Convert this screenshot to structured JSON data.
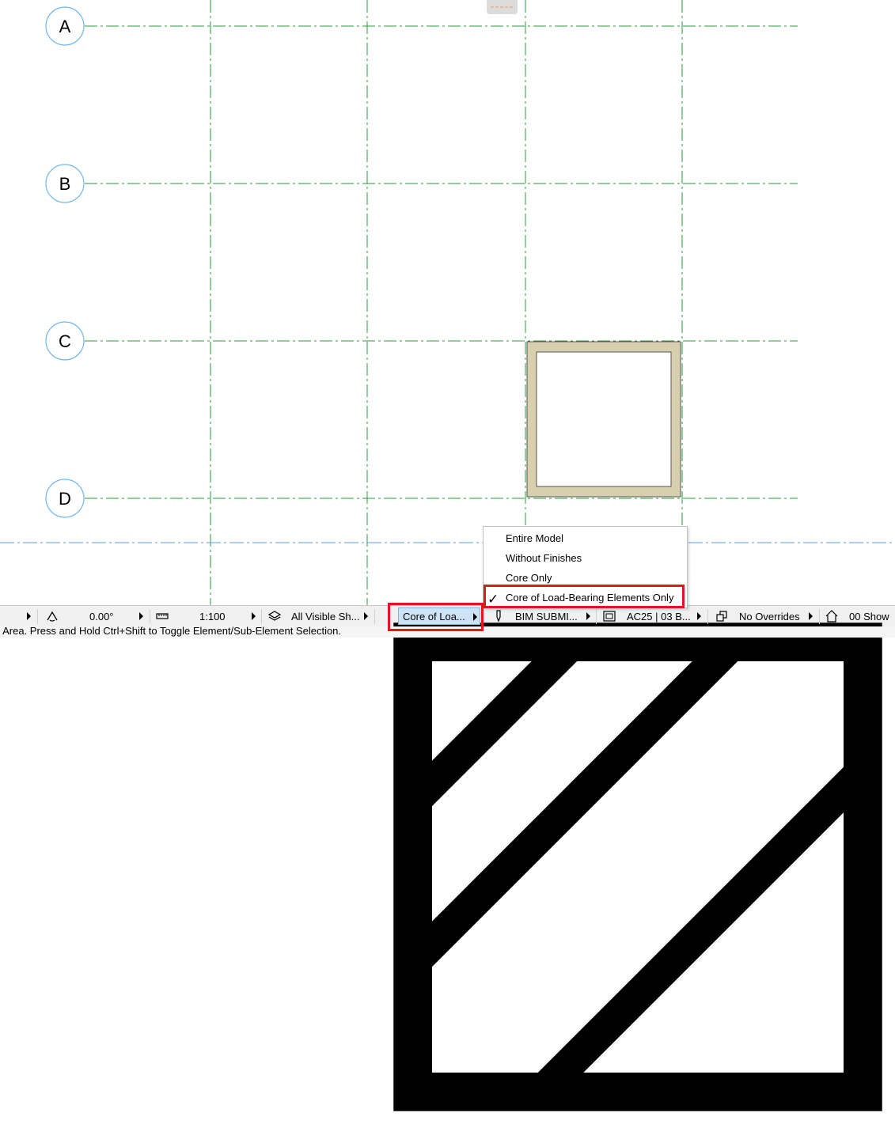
{
  "grid_axes": [
    "A",
    "B",
    "C",
    "D"
  ],
  "colors": {
    "grid_line": "#2a9a3a",
    "bubble": "#6db6ee",
    "highlight": "#e3161c",
    "wall_fill": "#d8cfae",
    "axis_line": "#5b9bd5"
  },
  "toolbar": {
    "angle_value": "0.00°",
    "scale_value": "1:100",
    "layer_combo": "All Visible Sh...",
    "structural_display": "Core of Loa...",
    "pen_set": "BIM SUBMI...",
    "model_view": "AC25 | 03 B...",
    "graphic_override": "No Overrides",
    "renovation_filter": "00 Show"
  },
  "structural_display_menu": {
    "items": [
      {
        "label": "Entire Model",
        "checked": false
      },
      {
        "label": "Without Finishes",
        "checked": false
      },
      {
        "label": "Core Only",
        "checked": false
      },
      {
        "label": "Core of Load-Bearing Elements Only",
        "checked": true
      }
    ],
    "check_glyph": "✓"
  },
  "status_bar": {
    "message": "o Area. Press and Hold Ctrl+Shift to Toggle Element/Sub-Element Selection."
  }
}
